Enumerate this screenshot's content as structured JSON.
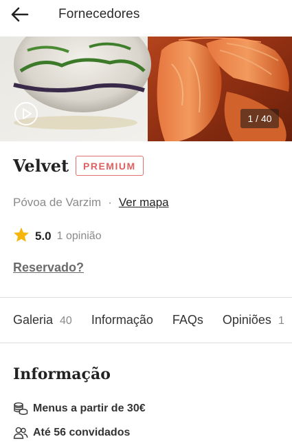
{
  "header": {
    "back_icon": "arrow-left-icon",
    "title": "Fornecedores"
  },
  "gallery": {
    "counter": "1 / 40",
    "play_icon": "play-circle-icon"
  },
  "vendor": {
    "name": "Velvet",
    "badge": "PREMIUM",
    "location": "Póvoa de Varzim",
    "separator": "·",
    "map_link": "Ver mapa",
    "rating": "5.0",
    "reviews": "1 opinião",
    "reserved_link": "Reservado?"
  },
  "tabs": [
    {
      "label": "Galeria",
      "count": "40"
    },
    {
      "label": "Informação",
      "count": ""
    },
    {
      "label": "FAQs",
      "count": ""
    },
    {
      "label": "Opiniões",
      "count": "1"
    }
  ],
  "info": {
    "title": "Informação",
    "items": [
      {
        "icon": "coins-icon",
        "text": "Menus a partir de 30€"
      },
      {
        "icon": "guests-icon",
        "text": "Até 56 convidados"
      }
    ]
  },
  "colors": {
    "badge": "#e06060",
    "star": "#f5b50a"
  }
}
